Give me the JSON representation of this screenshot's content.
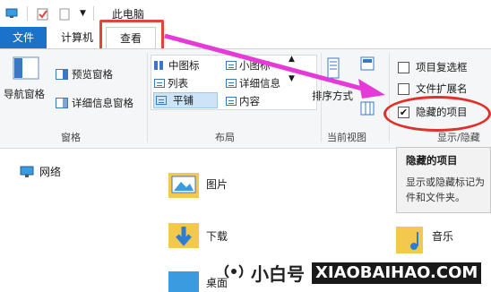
{
  "titlebar": {
    "title": "此电脑"
  },
  "tabs": {
    "file": "文件",
    "computer": "计算机",
    "view": "查看"
  },
  "ribbon": {
    "panes": {
      "nav_pane": "导航窗格",
      "preview_pane": "预览窗格",
      "details_pane": "详细信息窗格",
      "group_label": "窗格"
    },
    "layout": {
      "medium_icons": "中图标",
      "small_icons": "小图标",
      "list": "列表",
      "details": "详细信息",
      "tiles": "平铺",
      "content": "内容",
      "group_label": "布局"
    },
    "current_view": {
      "sort_by": "排序方式",
      "group_label": "当前视图"
    },
    "show_hide": {
      "item_checkboxes": "项目复选框",
      "file_extensions": "文件扩展名",
      "hidden_items": "隐藏的项目",
      "group_label": "显示/隐藏",
      "item_checkboxes_checked": false,
      "file_extensions_checked": false,
      "hidden_items_checked": true,
      "check_mark": "✔"
    }
  },
  "nav": {
    "network": "网络"
  },
  "files": {
    "pictures": "图片",
    "downloads": "下载",
    "music": "音乐",
    "desktop": "桌面"
  },
  "tooltip": {
    "title": "隐藏的项目",
    "line1": "显示或隐藏标记为",
    "line2": "件和文件夹。"
  },
  "watermark": {
    "cn": "小白号",
    "en": "XIAOBAIHAO.COM"
  },
  "colors": {
    "file_tab": "#1a73c8",
    "highlight_red": "#e0302a",
    "arrow_magenta": "#e53ad8",
    "folder_yellow": "#f2c94c"
  }
}
